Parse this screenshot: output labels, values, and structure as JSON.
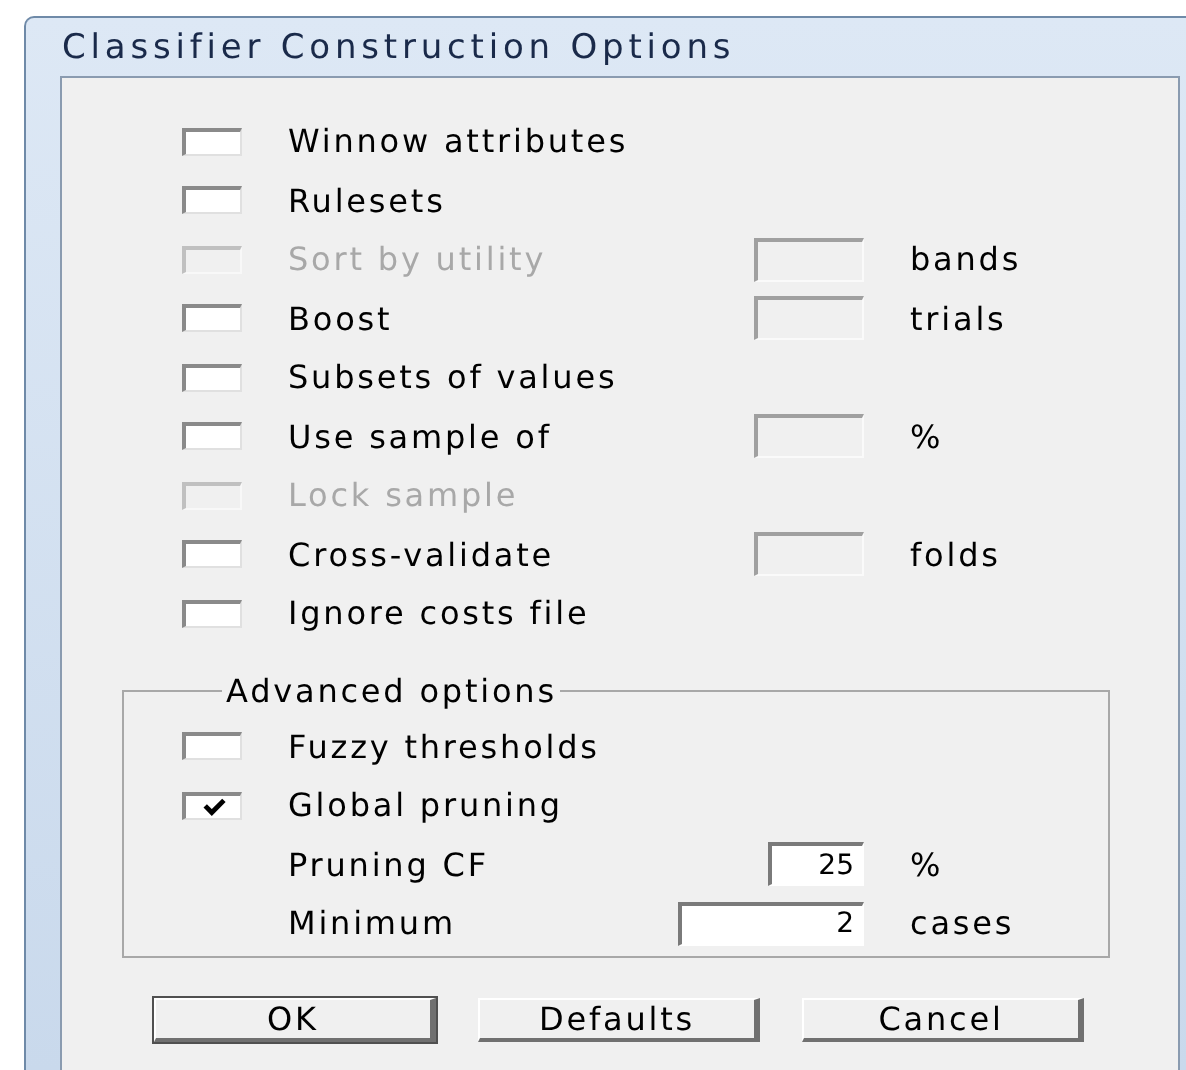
{
  "window": {
    "title": "Classifier Construction Options"
  },
  "options": [
    {
      "kind": "checkbox",
      "label": "Winnow attributes",
      "checked": false,
      "disabled": false
    },
    {
      "kind": "checkbox",
      "label": "Rulesets",
      "checked": false,
      "disabled": false
    },
    {
      "kind": "checkbox",
      "label": "Sort by utility",
      "checked": false,
      "disabled": true,
      "field": {
        "disabled": true
      },
      "unit": "bands"
    },
    {
      "kind": "checkbox",
      "label": "Boost",
      "checked": false,
      "disabled": false,
      "field": {
        "disabled": true
      },
      "unit": "trials"
    },
    {
      "kind": "checkbox",
      "label": "Subsets of values",
      "checked": false,
      "disabled": false
    },
    {
      "kind": "checkbox",
      "label": "Use sample of",
      "checked": false,
      "disabled": false,
      "field": {
        "disabled": true
      },
      "unit": "%"
    },
    {
      "kind": "checkbox",
      "label": "Lock sample",
      "checked": false,
      "disabled": true
    },
    {
      "kind": "checkbox",
      "label": "Cross-validate",
      "checked": false,
      "disabled": false,
      "field": {
        "disabled": true
      },
      "unit": "folds"
    },
    {
      "kind": "checkbox",
      "label": "Ignore costs file",
      "checked": false,
      "disabled": false
    }
  ],
  "advanced": {
    "title": "Advanced options",
    "options": [
      {
        "kind": "checkbox",
        "label": "Fuzzy thresholds",
        "checked": false,
        "disabled": false
      },
      {
        "kind": "checkbox",
        "label": "Global pruning",
        "checked": true,
        "disabled": false
      },
      {
        "kind": "field",
        "label": "Pruning CF",
        "field": {
          "value": "25",
          "disabled": false
        },
        "unit": "%"
      },
      {
        "kind": "longfield",
        "label": "Minimum",
        "field": {
          "value": "2",
          "disabled": false
        },
        "unit": "cases"
      }
    ]
  },
  "buttons": [
    {
      "label": "OK",
      "default": true
    },
    {
      "label": "Defaults",
      "default": false
    },
    {
      "label": "Cancel",
      "default": false
    }
  ]
}
